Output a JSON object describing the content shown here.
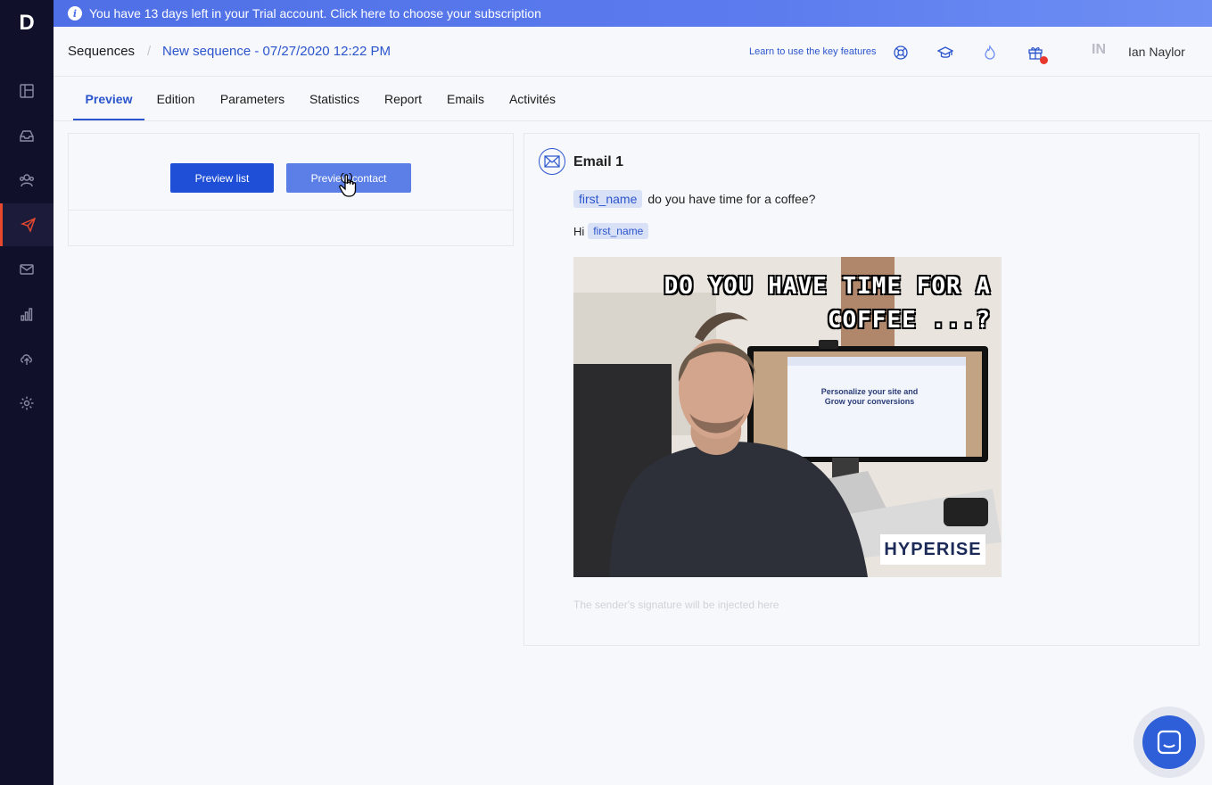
{
  "app": {
    "logo_letter": "D"
  },
  "trial_banner": {
    "text": "You have 13 days left in your Trial account. Click here to choose your subscription"
  },
  "breadcrumb": {
    "root": "Sequences",
    "separator": "/",
    "current": "New sequence - 07/27/2020 12:22 PM"
  },
  "header": {
    "learn_link": "Learn to use the key features",
    "avatar_initials": "IN",
    "user_name": "Ian Naylor"
  },
  "tabs": [
    {
      "label": "Preview",
      "active": true
    },
    {
      "label": "Edition"
    },
    {
      "label": "Parameters"
    },
    {
      "label": "Statistics"
    },
    {
      "label": "Report"
    },
    {
      "label": "Emails"
    },
    {
      "label": "Activités"
    }
  ],
  "left_panel": {
    "preview_list_label": "Preview list",
    "preview_contact_label": "Preview contact"
  },
  "email": {
    "title": "Email 1",
    "subject_tag": "first_name",
    "subject_text": "do you have time for a coffee?",
    "greeting": "Hi",
    "greeting_tag": "first_name",
    "image_headline_line1": "DO YOU HAVE TIME FOR A",
    "image_headline_line2": "COFFEE ...?",
    "image_brand": "HYPERISE",
    "monitor_text_line1": "Personalize your site and",
    "monitor_text_line2": "Grow your conversions",
    "signature_placeholder": "The sender's signature will be injected here"
  },
  "colors": {
    "accent": "#2b55cc",
    "sidebar_bg": "#10102b",
    "active_marker": "#e8482e",
    "banner": "#4f6fe6",
    "notification": "#e8382e"
  },
  "icons": {
    "sidebar": [
      "layout-icon",
      "inbox-icon",
      "contacts-icon",
      "send-icon",
      "mail-icon",
      "bar-chart-icon",
      "cloud-upload-icon",
      "gear-icon"
    ],
    "header": [
      "help-lifebuoy-icon",
      "graduation-cap-icon",
      "flame-icon",
      "gift-icon"
    ]
  }
}
